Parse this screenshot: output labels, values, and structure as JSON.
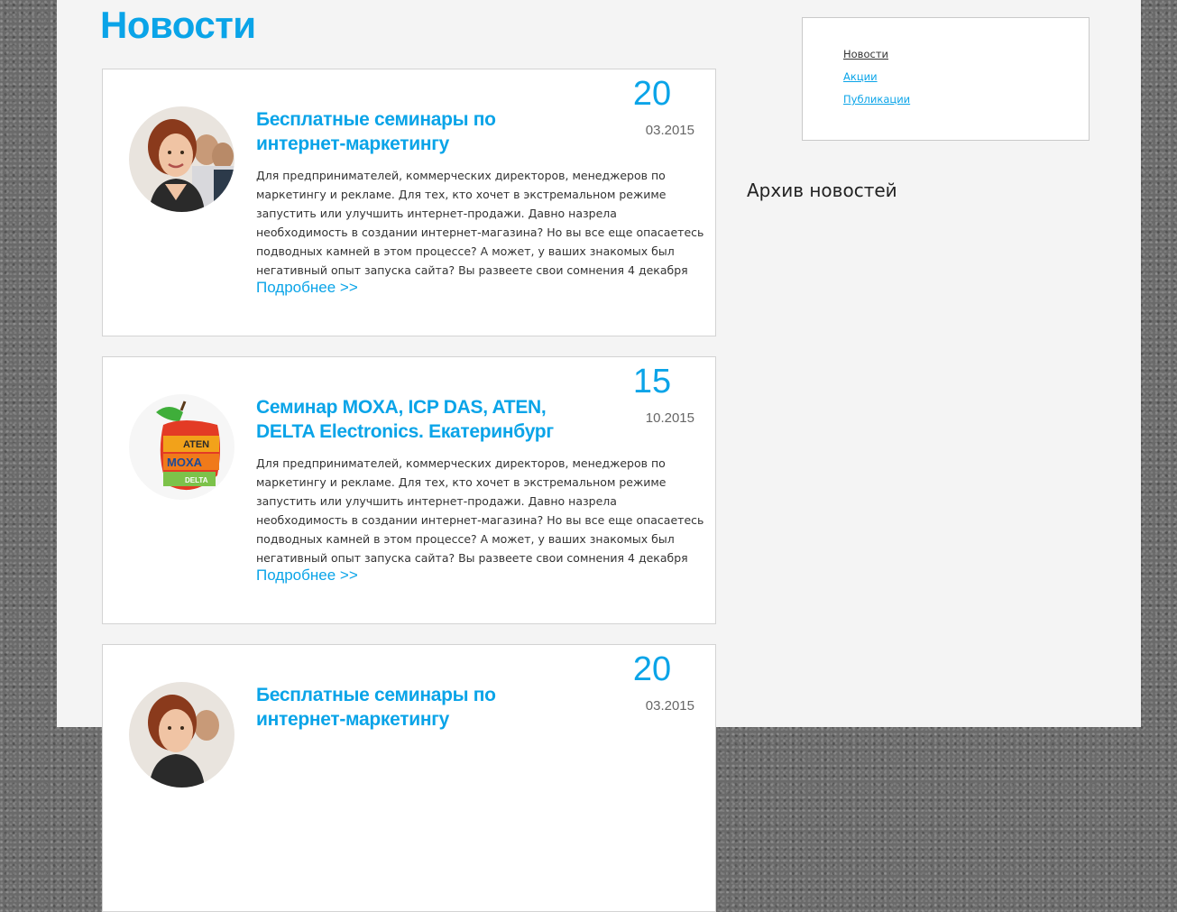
{
  "page": {
    "title": "Новости"
  },
  "news": [
    {
      "day": "20",
      "month_year": "03.2015",
      "title": "Бесплатные семинары по интернет-маркетингу",
      "text": "Для предпринимателей, коммерческих директоров, менеджеров по маркетингу и рекламе. Для тех, кто хочет в экстремальном режиме запустить или улучшить интернет-продажи. Давно назрела необходимость в создании интернет-магазина? Но вы все еще опасаетесь подводных камней в этом процессе? А может, у ваших знакомых был негативный опыт запуска сайта? Вы развеете свои сомнения 4 декабря",
      "more": "Подробнее >>",
      "image_icon": "woman-photo-icon"
    },
    {
      "day": "15",
      "month_year": "10.2015",
      "title": "Семинар MOXA, ICP DAS, ATEN, DELTA Electronics. Екатеринбург",
      "text": "Для предпринимателей, коммерческих директоров, менеджеров по маркетингу и рекламе. Для тех, кто хочет в экстремальном режиме запустить или улучшить интернет-продажи. Давно назрела необходимость в создании интернет-магазина? Но вы все еще опасаетесь подводных камней в этом процессе? А может, у ваших знакомых был негативный опыт запуска сайта? Вы развеете свои сомнения 4 декабря",
      "more": "Подробнее >>",
      "image_icon": "apple-logos-icon",
      "image_labels": [
        "ATEN",
        "MOXA",
        "DELTA"
      ]
    },
    {
      "day": "20",
      "month_year": "03.2015",
      "title": "Бесплатные семинары по интернет-маркетингу",
      "text": "",
      "more": "",
      "image_icon": "woman-photo-icon"
    }
  ],
  "sidebar": {
    "links": [
      {
        "label": "Новости",
        "active": true
      },
      {
        "label": "Акции",
        "active": false
      },
      {
        "label": "Публикации",
        "active": false
      }
    ],
    "archive_title": "Архив новостей"
  },
  "colors": {
    "accent": "#0aa4e8",
    "text": "#333333",
    "card_bg": "#ffffff",
    "page_bg": "#f4f4f4"
  }
}
